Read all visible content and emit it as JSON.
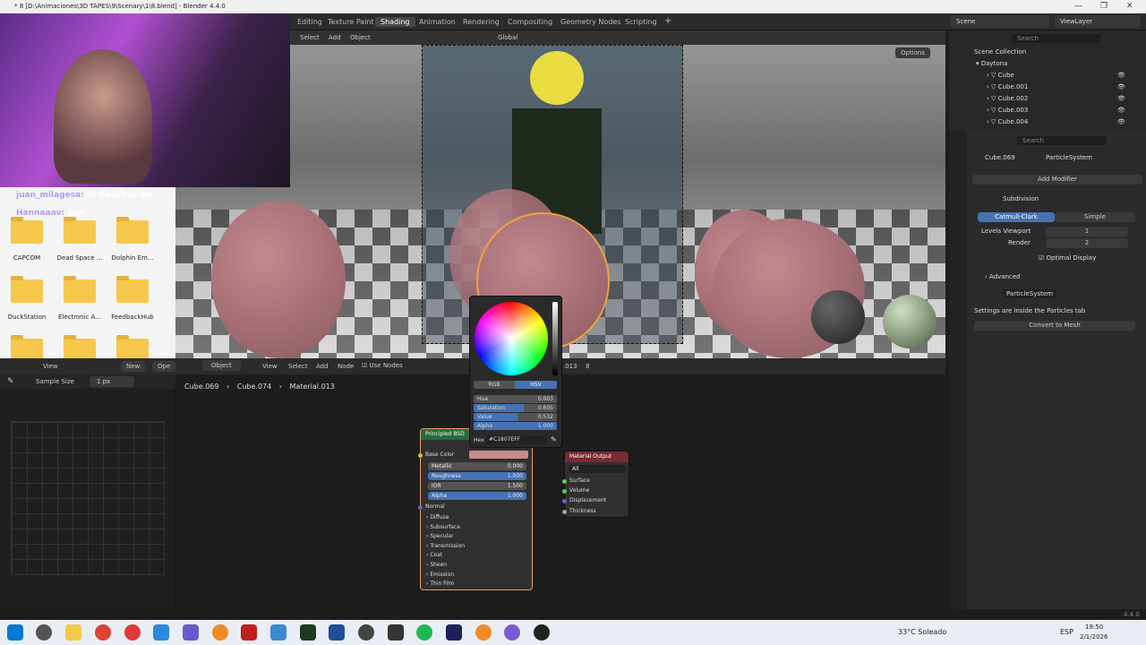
{
  "window": {
    "title": "* 8 [D:\\Animaciones\\3D TAPES\\9\\Scenary\\1\\8.blend] - Blender 4.4.0"
  },
  "workspace_tabs": [
    "Editing",
    "Texture Paint",
    "Shading",
    "Animation",
    "Rendering",
    "Compositing",
    "Geometry Nodes",
    "Scripting"
  ],
  "active_tab": "Shading",
  "scene": {
    "label": "Scene",
    "view_layer": "ViewLayer"
  },
  "viewport": {
    "menus": [
      "Select",
      "Add",
      "Object"
    ],
    "orientation": "Global",
    "options_label": "Options"
  },
  "explorer": {
    "folders": [
      "CAPCOM",
      "Dead Space ...",
      "Dolphin Em...",
      "DuckStation",
      "Electronic A...",
      "FeedbackHub"
    ]
  },
  "chat": [
    {
      "user": "juan_milagesa:",
      "msg": "re tiernitos aw"
    },
    {
      "user": "Hannaaav:",
      "msg": "boe"
    }
  ],
  "left_header": {
    "view": "View",
    "new": "New",
    "open": "Ope"
  },
  "sample": {
    "label": "Sample Size",
    "value": "1 px"
  },
  "node_header": {
    "mode": "Object",
    "menus": [
      "View",
      "Select",
      "Add",
      "Node"
    ],
    "use_nodes": "Use Nodes",
    "slot_count": "8",
    "material_suffix": ".013"
  },
  "breadcrumb": [
    "Cube.069",
    "Cube.074",
    "Material.013"
  ],
  "color_picker": {
    "modes": [
      "RGB",
      "HSV"
    ],
    "active_mode": "HSV",
    "hue": {
      "label": "Hue",
      "value": "0.003"
    },
    "saturation": {
      "label": "Saturation",
      "value": "0.605"
    },
    "value": {
      "label": "Value",
      "value": "0.532"
    },
    "alpha": {
      "label": "Alpha",
      "value": "1.000"
    },
    "hex_label": "Hex",
    "hex": "#C1807EFF"
  },
  "bsdf": {
    "title": "Principled BSD",
    "base_color": "Base Color",
    "metallic": {
      "label": "Metallic",
      "value": "0.000"
    },
    "roughness": {
      "label": "Roughness",
      "value": "1.000"
    },
    "ior": {
      "label": "IOR",
      "value": "1.500"
    },
    "alpha": {
      "label": "Alpha",
      "value": "1.000"
    },
    "normal": "Normal",
    "panels": [
      "Diffuse",
      "Subsurface",
      "Specular",
      "Transmission",
      "Coat",
      "Sheen",
      "Emission",
      "Thin Film"
    ],
    "base_color_swatch": "#c98a8c"
  },
  "material_output": {
    "title": "Material Output",
    "target": "All",
    "sockets": [
      "Surface",
      "Volume",
      "Displacement",
      "Thickness"
    ]
  },
  "outliner": {
    "search": "Search",
    "collection": "Scene Collection",
    "sub": "Daytona",
    "items": [
      "Cube",
      "Cube.001",
      "Cube.002",
      "Cube.003",
      "Cube.004"
    ]
  },
  "properties": {
    "search": "Search",
    "object": "Cube.069",
    "particle_path": "ParticleSystem",
    "add_modifier": "Add Modifier",
    "subdivision": {
      "name": "Subdivision",
      "catmull": "Catmull-Clark",
      "simple": "Simple",
      "levels_label": "Levels Viewport",
      "levels": "1",
      "render_label": "Render",
      "render": "2",
      "optimal": "Optimal Display",
      "advanced": "Advanced"
    },
    "particle": {
      "name": "ParticleSystem",
      "info": "Settings are inside the Particles tab",
      "convert": "Convert to Mesh"
    }
  },
  "version": "4.4.0",
  "taskbar": {
    "weather": "33°C  Soleado",
    "lang": "ESP",
    "time": "19:50",
    "date": "2/1/2026"
  },
  "colors": {
    "accent": "#4772b3",
    "orange_outline": "#f0a040",
    "bg": "#1d1d1d"
  }
}
